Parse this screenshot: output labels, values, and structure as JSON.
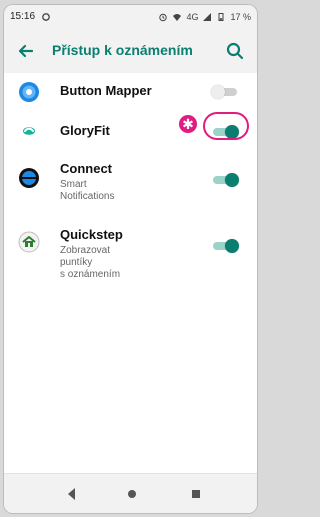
{
  "status": {
    "time": "15:16",
    "network": "4G",
    "battery": "17 %"
  },
  "header": {
    "title": "Přístup k oznámením"
  },
  "apps": [
    {
      "name": "Button Mapper",
      "subtitle": "",
      "enabled": false
    },
    {
      "name": "GloryFit",
      "subtitle": "",
      "enabled": true
    },
    {
      "name": "Connect",
      "subtitle": "Smart\nNotifications",
      "enabled": true
    },
    {
      "name": "Quickstep",
      "subtitle": "Zobrazovat\npuntíky\ns oznámením",
      "enabled": true
    }
  ],
  "colors": {
    "accent": "#0a7f6f",
    "annotation": "#e11b80"
  },
  "annotation": {
    "symbol": "✱"
  }
}
